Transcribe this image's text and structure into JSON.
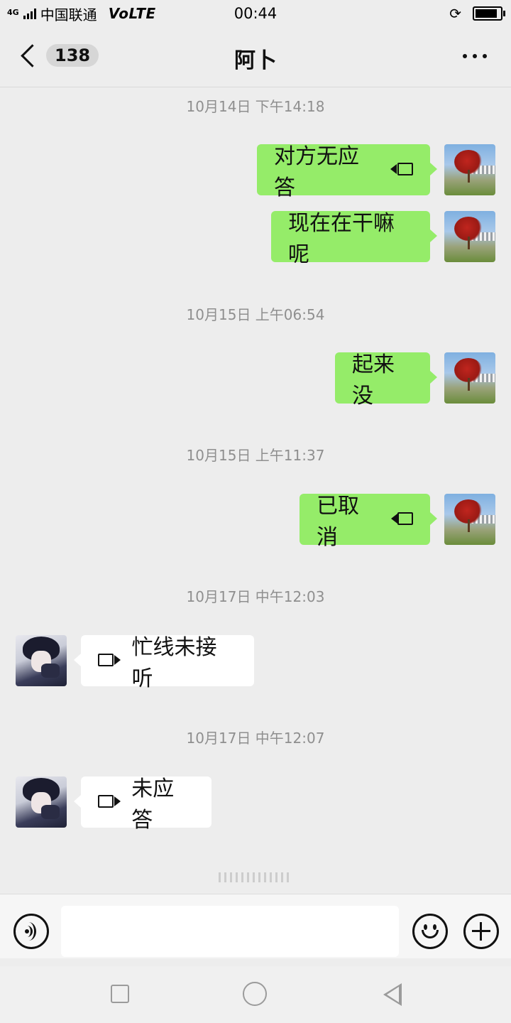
{
  "status_bar": {
    "network": "4G",
    "carrier": "中国联通",
    "volte": "VoLTE",
    "time": "00:44"
  },
  "header": {
    "unread_count": "138",
    "title": "阿卜"
  },
  "messages": [
    {
      "type": "time",
      "text": "10月14日 下午14:18"
    },
    {
      "type": "out",
      "text": "对方无应答",
      "icon": "video-call-icon"
    },
    {
      "type": "out",
      "text": "现在在干嘛呢"
    },
    {
      "type": "time",
      "text": "10月15日 上午06:54"
    },
    {
      "type": "out",
      "text": "起来没"
    },
    {
      "type": "time",
      "text": "10月15日 上午11:37"
    },
    {
      "type": "out",
      "text": "已取消",
      "icon": "video-call-icon"
    },
    {
      "type": "time",
      "text": "10月17日 中午12:03"
    },
    {
      "type": "in",
      "text": "忙线未接听",
      "icon": "video-call-icon"
    },
    {
      "type": "time",
      "text": "10月17日 中午12:07"
    },
    {
      "type": "in",
      "text": "未应答",
      "icon": "video-call-icon"
    }
  ],
  "input": {
    "placeholder": "",
    "value": ""
  },
  "colors": {
    "background": "#ededed",
    "outgoing_bubble": "#95ec69",
    "incoming_bubble": "#ffffff",
    "timestamp": "#8f8f8f"
  },
  "icons": {
    "voice": "voice-input-icon",
    "emoji": "emoji-icon",
    "plus": "plus-icon",
    "more": "more-dots-icon",
    "back": "back-chevron-icon"
  }
}
